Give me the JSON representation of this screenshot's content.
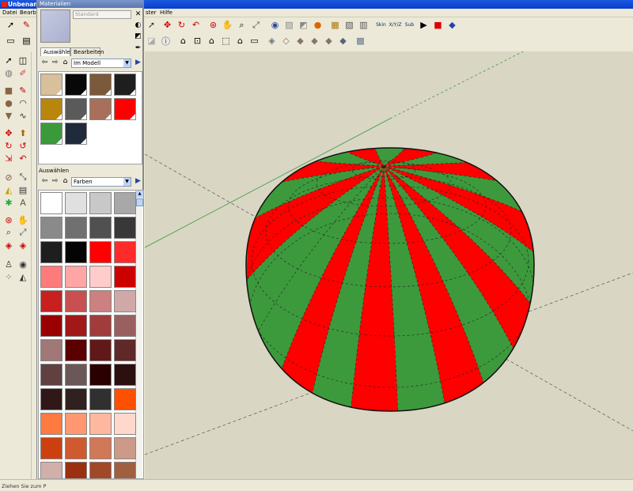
{
  "window": {
    "title": "Unbenann"
  },
  "menu": {
    "items": [
      "Datei",
      "Bearbei",
      "ster",
      "Hilfe"
    ]
  },
  "materials": {
    "panel_title": "Materialien",
    "material_name_placeholder": "Standard",
    "tabs": [
      "Auswählen",
      "Bearbeiten"
    ],
    "model_collection": "Im Modell",
    "lower_section_label": "Auswählen",
    "library_collection": "Farben",
    "model_swatches": [
      "#d8c09a",
      "#080808",
      "#7a5a3a",
      "#1e1e1e",
      "#b8860b",
      "#5a5a5a",
      "#a8705a",
      "#ff0000",
      "#3a9a3a",
      "#1f2a3a"
    ],
    "library_swatches": [
      "#ffffff",
      "#e0e0e0",
      "#c8c8c8",
      "#a8a8a8",
      "#8a8a8a",
      "#707070",
      "#505050",
      "#383838",
      "#1e1e1e",
      "#040404",
      "#ff0000",
      "#ff2b2b",
      "#ff7b7b",
      "#ffa5a5",
      "#ffcccc",
      "#cc0000",
      "#c82020",
      "#c85050",
      "#cc8080",
      "#d0a8a8",
      "#9a0000",
      "#a01818",
      "#a03c3c",
      "#9a6060",
      "#a07878",
      "#5a0000",
      "#601818",
      "#602828",
      "#604040",
      "#6a5858",
      "#2a0000",
      "#2c1010",
      "#301818",
      "#302020",
      "#303030",
      "#ff5000",
      "#ff7a40",
      "#ff9870",
      "#ffb8a0",
      "#ffd8cc",
      "#cc4010",
      "#d05a30",
      "#d07858",
      "#cc9a88",
      "#d0b0a8",
      "#9a3010",
      "#a04828",
      "#a06040"
    ]
  },
  "toolbar": {
    "skin_label": "Skin",
    "xyz_label": "X/Y/Z",
    "sub_label": "Sub"
  },
  "status": {
    "text": "Ziehen Sie zum P"
  },
  "colors": {
    "viewport_bg": "#d9d7c4",
    "dome_red": "#ff0000",
    "dome_green": "#3c9a3c",
    "chrome": "#ece9d8"
  }
}
